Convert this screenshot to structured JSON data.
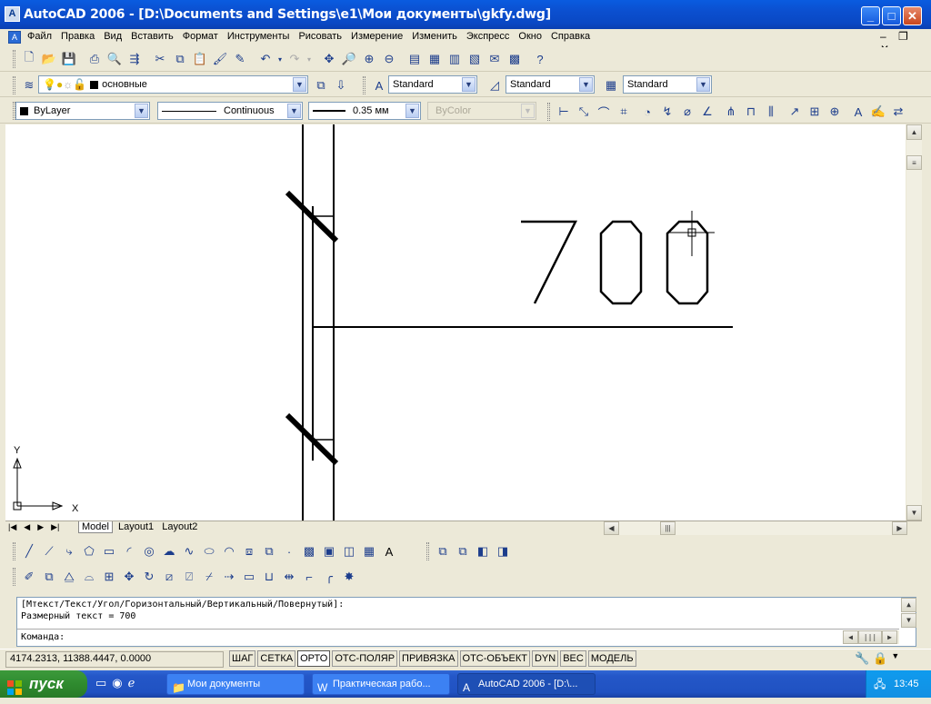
{
  "window": {
    "title": "AutoCAD 2006 - [D:\\Documents and Settings\\e1\\Мои документы\\gkfy.dwg]",
    "icon": "autocad-app-icon",
    "buttons": [
      "minimize",
      "maximize",
      "close"
    ]
  },
  "menu": {
    "items": [
      "Файл",
      "Правка",
      "Вид",
      "Вставить",
      "Формат",
      "Инструменты",
      "Рисовать",
      "Измерение",
      "Изменить",
      "Экспресс",
      "Окно",
      "Справка"
    ]
  },
  "layers": {
    "current_layer": "основные"
  },
  "styles": {
    "text_style": "Standard",
    "dim_style": "Standard",
    "table_style": "Standard"
  },
  "properties": {
    "color": "ByLayer",
    "linetype": "Continuous",
    "lineweight": "0.35 мм",
    "plot_style": "ByColor"
  },
  "drawing": {
    "dimension_text": "700",
    "ucs_x_label": "X",
    "ucs_y_label": "Y"
  },
  "layout_tabs": {
    "tabs": [
      "Model",
      "Layout1",
      "Layout2"
    ],
    "active": "Model"
  },
  "command": {
    "line1": "[Мтекст/Текст/Угол/Горизонтальный/Вертикальный/Повернутый]:",
    "line2": "Размерный текст = 700",
    "prompt": "Команда:"
  },
  "status": {
    "coordinates": "4174.2313, 11388.4447, 0.0000",
    "toggles": [
      {
        "label": "ШАГ",
        "on": false
      },
      {
        "label": "СЕТКА",
        "on": false
      },
      {
        "label": "ОРТО",
        "on": true
      },
      {
        "label": "ОТС-ПОЛЯР",
        "on": false
      },
      {
        "label": "ПРИВЯЗКА",
        "on": false
      },
      {
        "label": "ОТС-ОБЪЕКТ",
        "on": false
      },
      {
        "label": "DYN",
        "on": false
      },
      {
        "label": "ВЕС",
        "on": false
      },
      {
        "label": "МОДЕЛЬ",
        "on": false
      }
    ]
  },
  "taskbar": {
    "start_label": "пуск",
    "buttons": [
      {
        "label": "Мои документы",
        "active": false
      },
      {
        "label": "Практическая рабо...",
        "active": false
      },
      {
        "label": "AutoCAD 2006 - [D:\\...",
        "active": true
      }
    ],
    "clock": "13:45"
  }
}
